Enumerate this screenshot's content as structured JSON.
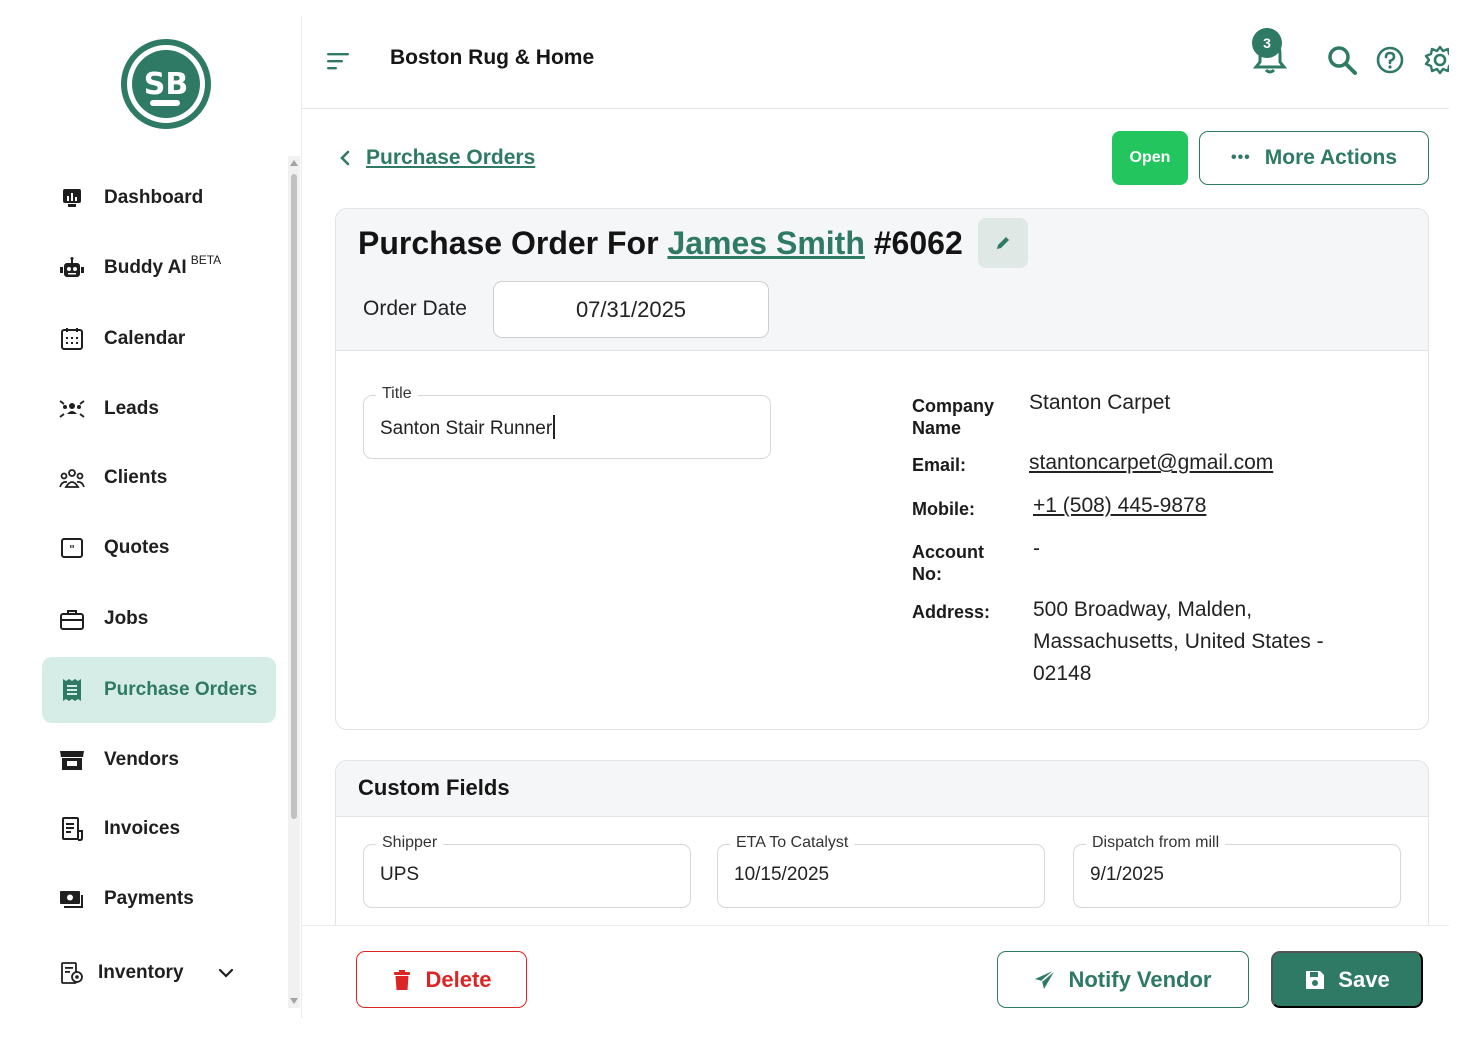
{
  "header": {
    "app_title": "Boston Rug & Home",
    "notification_count": "3"
  },
  "sidebar": {
    "logo_text": "SB",
    "items": [
      {
        "label": "Dashboard",
        "icon": "dashboard-icon"
      },
      {
        "label": "Buddy AI",
        "badge": "BETA",
        "icon": "robot-icon"
      },
      {
        "label": "Calendar",
        "icon": "calendar-icon"
      },
      {
        "label": "Leads",
        "icon": "leads-icon"
      },
      {
        "label": "Clients",
        "icon": "clients-icon"
      },
      {
        "label": "Quotes",
        "icon": "quotes-icon"
      },
      {
        "label": "Jobs",
        "icon": "briefcase-icon"
      },
      {
        "label": "Purchase Orders",
        "icon": "receipt-icon",
        "active": true
      },
      {
        "label": "Vendors",
        "icon": "store-icon"
      },
      {
        "label": "Invoices",
        "icon": "invoice-icon"
      },
      {
        "label": "Payments",
        "icon": "payments-icon"
      },
      {
        "label": "Inventory",
        "icon": "inventory-icon"
      }
    ]
  },
  "page": {
    "back_label": "Purchase Orders",
    "status": "Open",
    "more_actions": "More Actions",
    "title_prefix": "Purchase Order For",
    "customer": "James Smith",
    "number": "#6062",
    "order_date_label": "Order Date",
    "order_date": "07/31/2025",
    "title_field": {
      "label": "Title",
      "value": "Santon Stair Runner"
    },
    "vendor": {
      "company_label": "Company Name",
      "company": "Stanton Carpet",
      "email_label": "Email:",
      "email": "stantoncarpet@gmail.com",
      "mobile_label": "Mobile:",
      "mobile": "+1 (508) 445-9878",
      "account_label": "Account No:",
      "account": "-",
      "address_label": "Address:",
      "address_line1": "500 Broadway, Malden,",
      "address_line2": "Massachusetts, United States -",
      "address_line3": "02148"
    },
    "custom_fields": {
      "title": "Custom Fields",
      "fields": [
        {
          "label": "Shipper",
          "value": "UPS"
        },
        {
          "label": "ETA To Catalyst",
          "value": "10/15/2025"
        },
        {
          "label": "Dispatch from mill",
          "value": "9/1/2025"
        }
      ]
    }
  },
  "footer": {
    "delete": "Delete",
    "notify": "Notify Vendor",
    "save": "Save"
  },
  "colors": {
    "brand": "#2f7a64",
    "open": "#22c55e",
    "danger": "#dc2626"
  }
}
